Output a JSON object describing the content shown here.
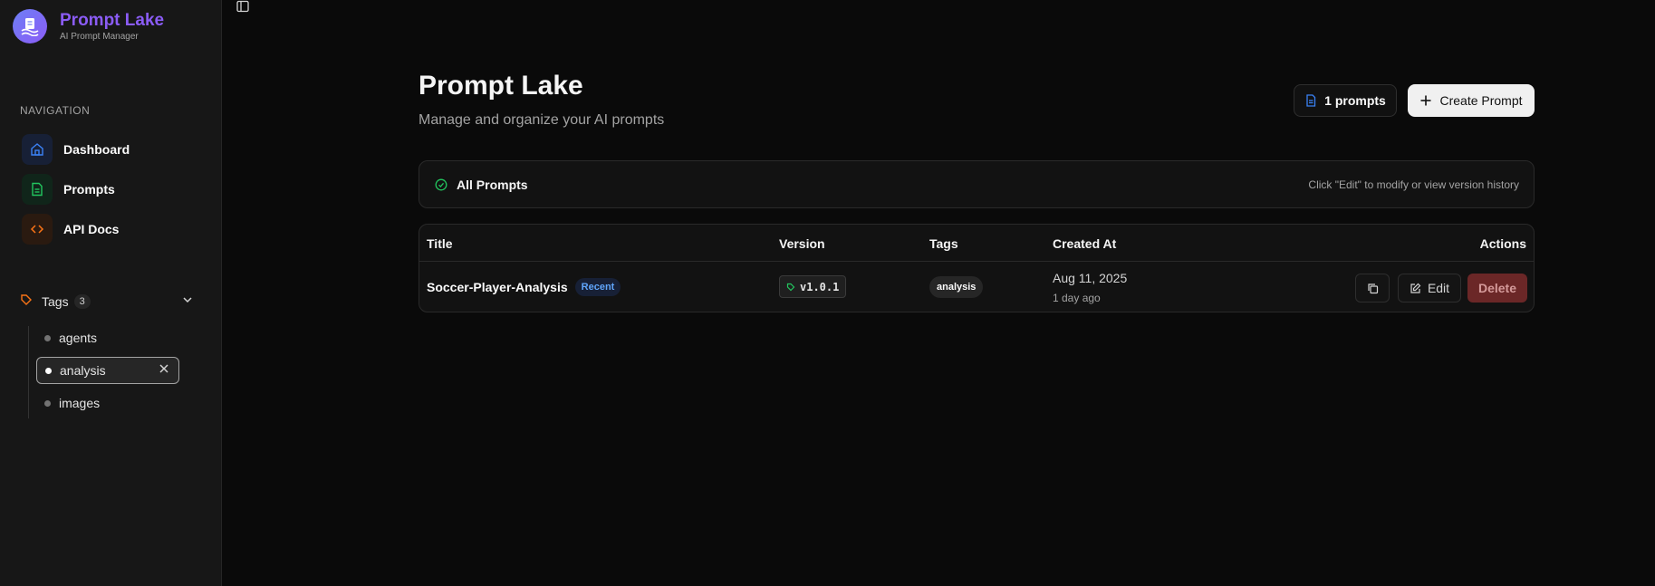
{
  "brand": {
    "title": "Prompt Lake",
    "subtitle": "AI Prompt Manager",
    "logo_icon": "document-waves-icon"
  },
  "sidebar": {
    "nav_heading": "NAVIGATION",
    "items": [
      {
        "label": "Dashboard",
        "icon": "home-icon",
        "color": "#3b82f6"
      },
      {
        "label": "Prompts",
        "icon": "file-text-icon",
        "color": "#22c55e"
      },
      {
        "label": "API Docs",
        "icon": "code-icon",
        "color": "#f97316"
      }
    ],
    "tags": {
      "label": "Tags",
      "count": "3",
      "items": [
        {
          "name": "agents",
          "active": false
        },
        {
          "name": "analysis",
          "active": true
        },
        {
          "name": "images",
          "active": false
        }
      ]
    }
  },
  "header": {
    "title": "Prompt Lake",
    "subtitle": "Manage and organize your AI prompts",
    "count_label": "1 prompts",
    "create_label": "Create Prompt"
  },
  "panel": {
    "title": "All Prompts",
    "hint": "Click \"Edit\" to modify or view version history"
  },
  "table": {
    "columns": [
      "Title",
      "Version",
      "Tags",
      "Created At",
      "Actions"
    ],
    "rows": [
      {
        "title": "Soccer-Player-Analysis",
        "badge": "Recent",
        "version": "v1.0.1",
        "tag": "analysis",
        "created_date": "Aug 11, 2025",
        "created_relative": "1 day ago",
        "edit_label": "Edit",
        "delete_label": "Delete"
      }
    ]
  },
  "colors": {
    "accent": "#8b5cf6",
    "delete": "#6b2727",
    "recent": "#60a5fa"
  }
}
